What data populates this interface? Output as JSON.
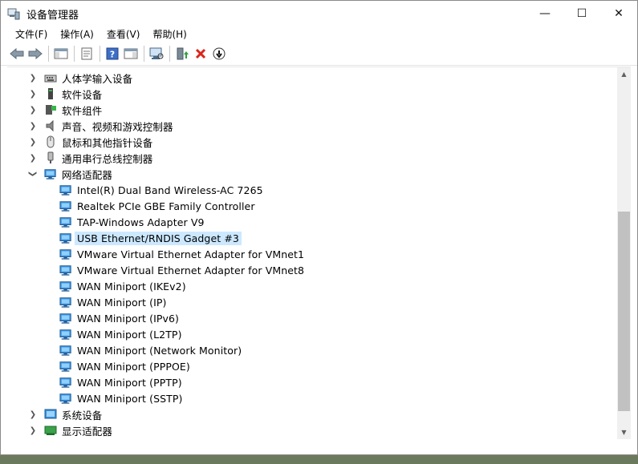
{
  "window": {
    "title": "设备管理器",
    "min_glyph": "—",
    "max_glyph": "☐",
    "close_glyph": "✕"
  },
  "menu": [
    {
      "label": "文件(F)"
    },
    {
      "label": "操作(A)"
    },
    {
      "label": "查看(V)"
    },
    {
      "label": "帮助(H)"
    }
  ],
  "toolbar": {
    "buttons": [
      "back-icon",
      "forward-icon",
      "show-hide-console-tree-icon",
      "properties-icon",
      "help-icon",
      "action-pane-icon",
      "scan-hardware-icon",
      "update-driver-icon",
      "uninstall-icon",
      "disable-device-icon"
    ]
  },
  "tree": {
    "categories": [
      {
        "label": "人体学输入设备",
        "icon": "hid-icon",
        "expanded": false
      },
      {
        "label": "软件设备",
        "icon": "software-device-icon",
        "expanded": false
      },
      {
        "label": "软件组件",
        "icon": "software-component-icon",
        "expanded": false
      },
      {
        "label": "声音、视频和游戏控制器",
        "icon": "speaker-icon",
        "expanded": false
      },
      {
        "label": "鼠标和其他指针设备",
        "icon": "mouse-icon",
        "expanded": false
      },
      {
        "label": "通用串行总线控制器",
        "icon": "usb-icon",
        "expanded": false
      },
      {
        "label": "网络适配器",
        "icon": "network-adapter-icon",
        "expanded": true
      }
    ],
    "network_children": [
      {
        "label": "Intel(R) Dual Band Wireless-AC 7265"
      },
      {
        "label": "Realtek PCIe GBE Family Controller"
      },
      {
        "label": "TAP-Windows Adapter V9"
      },
      {
        "label": "USB Ethernet/RNDIS Gadget #3",
        "selected": true
      },
      {
        "label": "VMware Virtual Ethernet Adapter for VMnet1"
      },
      {
        "label": "VMware Virtual Ethernet Adapter for VMnet8"
      },
      {
        "label": "WAN Miniport (IKEv2)"
      },
      {
        "label": "WAN Miniport (IP)"
      },
      {
        "label": "WAN Miniport (IPv6)"
      },
      {
        "label": "WAN Miniport (L2TP)"
      },
      {
        "label": "WAN Miniport (Network Monitor)"
      },
      {
        "label": "WAN Miniport (PPPOE)"
      },
      {
        "label": "WAN Miniport (PPTP)"
      },
      {
        "label": "WAN Miniport (SSTP)"
      }
    ],
    "after": [
      {
        "label": "系统设备",
        "icon": "system-device-icon",
        "expanded": false
      },
      {
        "label": "显示适配器",
        "icon": "display-adapter-icon",
        "expanded": false
      }
    ]
  },
  "scrollbar": {
    "position_fraction": 0.45,
    "visible_fraction": 0.58
  }
}
